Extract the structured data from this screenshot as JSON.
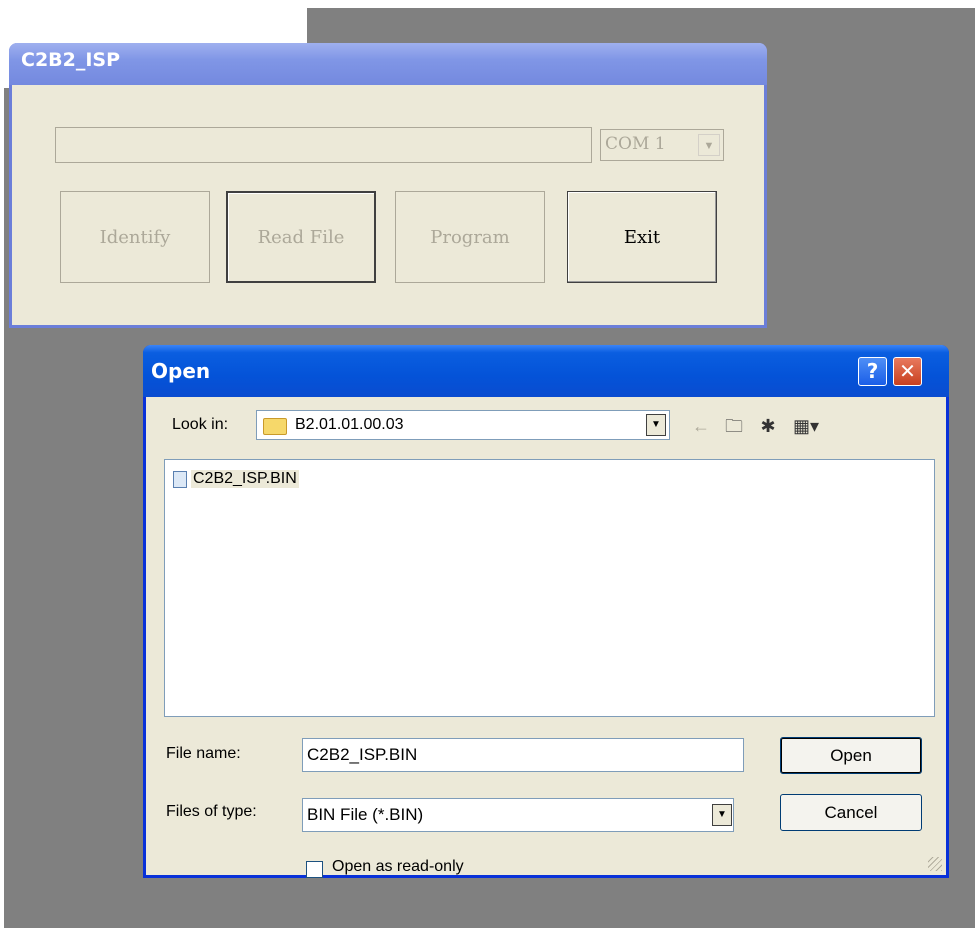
{
  "main_window": {
    "title": "C2B2_ISP",
    "port": "COM 1",
    "buttons": {
      "identify": "Identify",
      "read_file": "Read File",
      "program": "Program",
      "exit": "Exit"
    }
  },
  "open_dialog": {
    "title": "Open",
    "help_label": "?",
    "close_label": "✕",
    "look_in_label": "Look in:",
    "look_in_value": "B2.01.01.00.03",
    "files": [
      "C2B2_ISP.BIN"
    ],
    "file_name_label": "File name:",
    "file_name_value": "C2B2_ISP.BIN",
    "files_of_type_label": "Files of type:",
    "files_of_type_value": "BIN File (*.BIN)",
    "open_button": "Open",
    "cancel_button": "Cancel",
    "read_only_label": "Open as read-only"
  }
}
